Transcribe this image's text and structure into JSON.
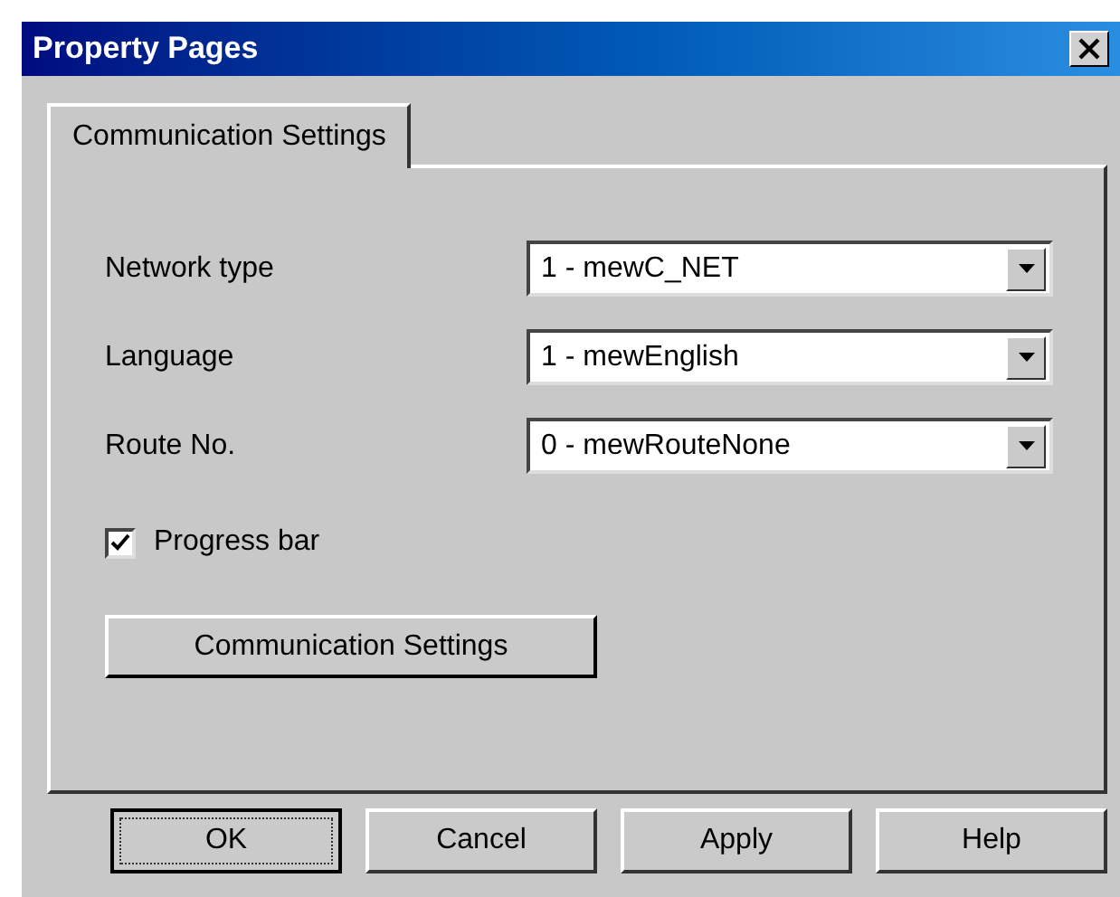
{
  "window": {
    "title": "Property Pages"
  },
  "tabs": [
    {
      "label": "Communication Settings",
      "selected": true
    }
  ],
  "fields": [
    {
      "label": "Network type",
      "value": "1 - mewC_NET"
    },
    {
      "label": "Language",
      "value": "1 - mewEnglish"
    },
    {
      "label": "Route No.",
      "value": "0 - mewRouteNone"
    }
  ],
  "progress_bar": {
    "label": "Progress bar",
    "checked": true
  },
  "settings_button": "Communication Settings",
  "buttons": [
    {
      "label": "OK",
      "default": true
    },
    {
      "label": "Cancel",
      "default": false
    },
    {
      "label": "Apply",
      "default": false
    },
    {
      "label": "Help",
      "default": false
    }
  ]
}
